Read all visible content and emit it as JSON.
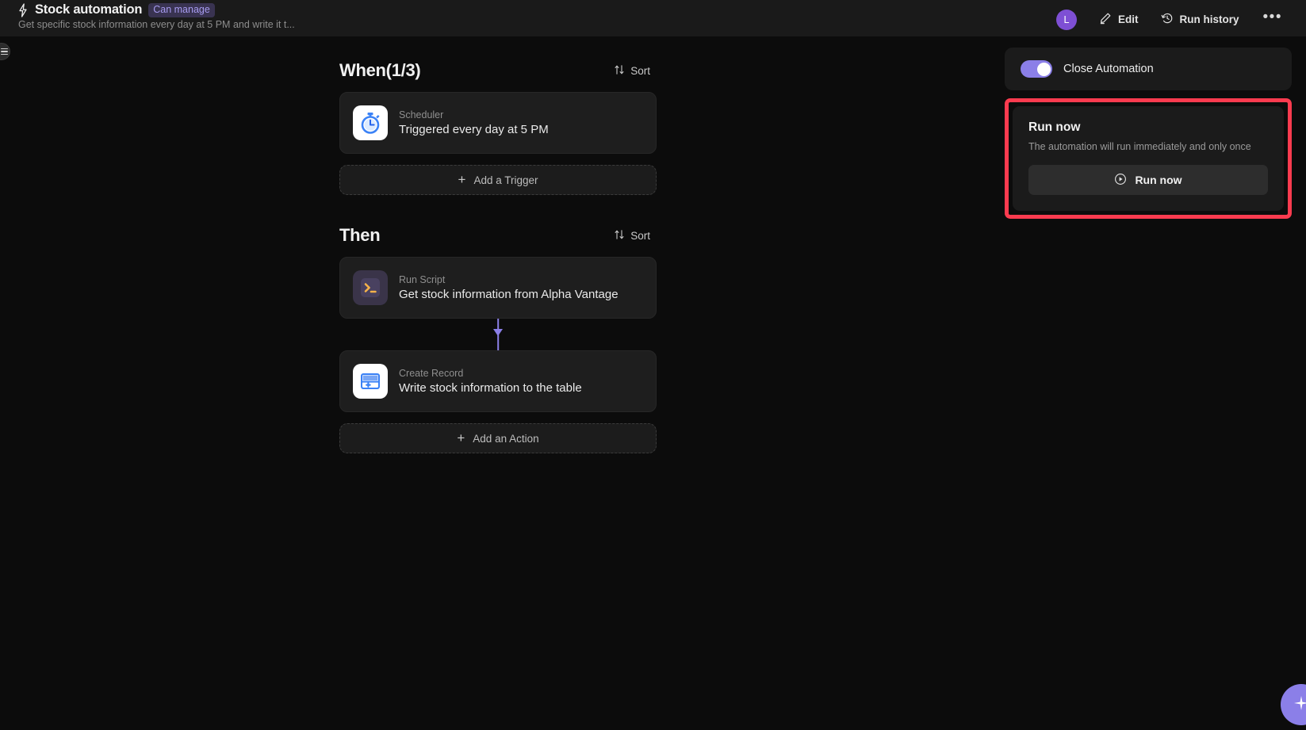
{
  "header": {
    "bolt_icon": "bolt-icon",
    "title": "Stock automation",
    "badge": "Can manage",
    "subtitle": "Get specific stock information every day at 5 PM and write it t...",
    "avatar_initial": "L",
    "edit_label": "Edit",
    "edit_icon": "pencil-icon",
    "run_history_label": "Run history",
    "run_history_icon": "history-icon",
    "more_label": "•••"
  },
  "rail": {
    "toggle_icon": "hamburger-icon"
  },
  "flow": {
    "when": {
      "title": "When(1/3)",
      "sort_label": "Sort",
      "sort_icon": "sort-arrows-icon",
      "cards": [
        {
          "icon": "stopwatch-icon",
          "kind": "Scheduler",
          "desc": "Triggered every day at 5 PM"
        }
      ],
      "add_label": "Add a Trigger",
      "add_icon": "plus-icon"
    },
    "then": {
      "title": "Then",
      "sort_label": "Sort",
      "sort_icon": "sort-arrows-icon",
      "cards": [
        {
          "icon": "terminal-icon",
          "kind": "Run Script",
          "desc": "Get stock information from Alpha Vantage"
        },
        {
          "icon": "create-record-icon",
          "kind": "Create Record",
          "desc": "Write stock information to the table"
        }
      ],
      "add_label": "Add an Action",
      "add_icon": "plus-icon"
    }
  },
  "right_panel": {
    "toggle_label": "Close Automation",
    "toggle_on": true,
    "run_now": {
      "title": "Run now",
      "subtitle": "The automation will run immediately and only once",
      "button_label": "Run now",
      "button_icon": "play-circle-icon"
    },
    "highlight_color": "#fb3b4f"
  },
  "fab": {
    "icon": "sparkle-icon"
  },
  "colors": {
    "accent_purple": "#8b7fe8",
    "badge_text": "#a79bf0",
    "avatar": "#7e4fd4",
    "header_bg": "#1a1a1a",
    "body_bg": "#0c0c0c",
    "card_bg": "#1e1e1e"
  }
}
